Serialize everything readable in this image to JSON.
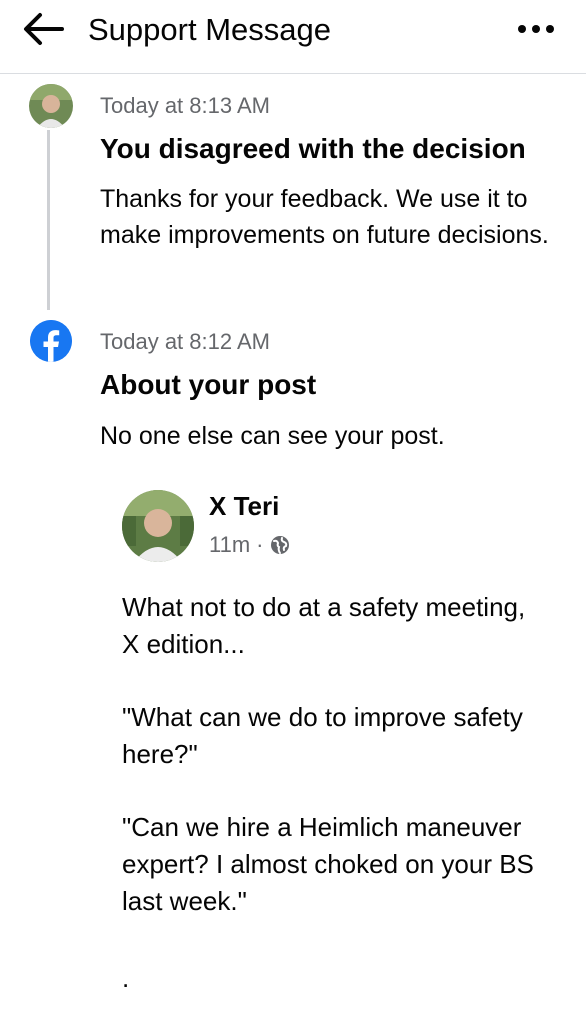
{
  "header": {
    "title": "Support Message",
    "back_icon": "arrow-left-icon",
    "more_icon": "more-horizontal-icon"
  },
  "messages": [
    {
      "time": "Today at 8:13 AM",
      "title": "You disagreed with the decision",
      "body": "Thanks for your feedback. We use it to make improvements on future decisions."
    },
    {
      "time": "Today at 8:12 AM",
      "title": "About your post",
      "body": "No one else can see your post."
    }
  ],
  "post": {
    "author": "X Teri",
    "age": "11m",
    "separator": "·",
    "audience_icon": "globe-icon",
    "paragraphs": [
      "What not to do at a safety meeting, X edition...",
      "\"What can we do to improve safety here?\"",
      "\"Can we hire a Heimlich maneuver expert? I almost choked on your BS last week.\"",
      "."
    ]
  },
  "colors": {
    "facebook_blue": "#1877f2",
    "secondary_text": "#65676b",
    "divider": "#dadde1"
  }
}
